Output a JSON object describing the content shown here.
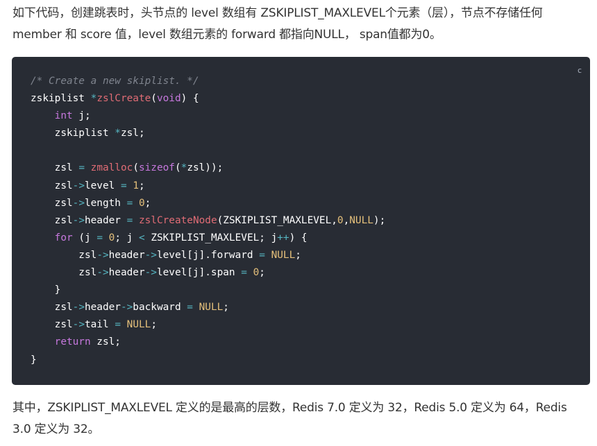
{
  "intro": {
    "text": "如下代码，创建跳表时，头节点的 level 数组有 ZSKIPLIST_MAXLEVEL个元素（层），节点不存储任何 member 和 score 值，level 数组元素的 forward 都指向NULL， span值都为0。"
  },
  "code_block": {
    "language_label": "c",
    "lines": [
      [
        [
          "com",
          "/* Create a new skiplist. */"
        ]
      ],
      [
        [
          "txt",
          "zskiplist "
        ],
        [
          "op",
          "*"
        ],
        [
          "fn",
          "zslCreate"
        ],
        [
          "txt",
          "("
        ],
        [
          "kw",
          "void"
        ],
        [
          "txt",
          ") {"
        ]
      ],
      [
        [
          "txt",
          "    "
        ],
        [
          "kw",
          "int"
        ],
        [
          "txt",
          " j;"
        ]
      ],
      [
        [
          "txt",
          "    zskiplist "
        ],
        [
          "op",
          "*"
        ],
        [
          "txt",
          "zsl;"
        ]
      ],
      [],
      [
        [
          "txt",
          "    zsl "
        ],
        [
          "op",
          "="
        ],
        [
          "txt",
          " "
        ],
        [
          "fn",
          "zmalloc"
        ],
        [
          "txt",
          "("
        ],
        [
          "kw",
          "sizeof"
        ],
        [
          "txt",
          "("
        ],
        [
          "op",
          "*"
        ],
        [
          "txt",
          "zsl));"
        ]
      ],
      [
        [
          "txt",
          "    zsl"
        ],
        [
          "op",
          "->"
        ],
        [
          "txt",
          "level "
        ],
        [
          "op",
          "="
        ],
        [
          "txt",
          " "
        ],
        [
          "num",
          "1"
        ],
        [
          "txt",
          ";"
        ]
      ],
      [
        [
          "txt",
          "    zsl"
        ],
        [
          "op",
          "->"
        ],
        [
          "txt",
          "length "
        ],
        [
          "op",
          "="
        ],
        [
          "txt",
          " "
        ],
        [
          "num",
          "0"
        ],
        [
          "txt",
          ";"
        ]
      ],
      [
        [
          "txt",
          "    zsl"
        ],
        [
          "op",
          "->"
        ],
        [
          "txt",
          "header "
        ],
        [
          "op",
          "="
        ],
        [
          "txt",
          " "
        ],
        [
          "fn",
          "zslCreateNode"
        ],
        [
          "txt",
          "(ZSKIPLIST_MAXLEVEL,"
        ],
        [
          "num",
          "0"
        ],
        [
          "txt",
          ","
        ],
        [
          "num",
          "NULL"
        ],
        [
          "txt",
          ");"
        ]
      ],
      [
        [
          "txt",
          "    "
        ],
        [
          "kw",
          "for"
        ],
        [
          "txt",
          " (j "
        ],
        [
          "op",
          "="
        ],
        [
          "txt",
          " "
        ],
        [
          "num",
          "0"
        ],
        [
          "txt",
          "; j "
        ],
        [
          "op",
          "<"
        ],
        [
          "txt",
          " ZSKIPLIST_MAXLEVEL; j"
        ],
        [
          "op",
          "++"
        ],
        [
          "txt",
          ") {"
        ]
      ],
      [
        [
          "txt",
          "        zsl"
        ],
        [
          "op",
          "->"
        ],
        [
          "txt",
          "header"
        ],
        [
          "op",
          "->"
        ],
        [
          "txt",
          "level[j].forward "
        ],
        [
          "op",
          "="
        ],
        [
          "txt",
          " "
        ],
        [
          "num",
          "NULL"
        ],
        [
          "txt",
          ";"
        ]
      ],
      [
        [
          "txt",
          "        zsl"
        ],
        [
          "op",
          "->"
        ],
        [
          "txt",
          "header"
        ],
        [
          "op",
          "->"
        ],
        [
          "txt",
          "level[j].span "
        ],
        [
          "op",
          "="
        ],
        [
          "txt",
          " "
        ],
        [
          "num",
          "0"
        ],
        [
          "txt",
          ";"
        ]
      ],
      [
        [
          "txt",
          "    }"
        ]
      ],
      [
        [
          "txt",
          "    zsl"
        ],
        [
          "op",
          "->"
        ],
        [
          "txt",
          "header"
        ],
        [
          "op",
          "->"
        ],
        [
          "txt",
          "backward "
        ],
        [
          "op",
          "="
        ],
        [
          "txt",
          " "
        ],
        [
          "num",
          "NULL"
        ],
        [
          "txt",
          ";"
        ]
      ],
      [
        [
          "txt",
          "    zsl"
        ],
        [
          "op",
          "->"
        ],
        [
          "txt",
          "tail "
        ],
        [
          "op",
          "="
        ],
        [
          "txt",
          " "
        ],
        [
          "num",
          "NULL"
        ],
        [
          "txt",
          ";"
        ]
      ],
      [
        [
          "txt",
          "    "
        ],
        [
          "kw",
          "return"
        ],
        [
          "txt",
          " zsl;"
        ]
      ],
      [
        [
          "txt",
          "}"
        ]
      ]
    ]
  },
  "outro": {
    "text": "其中，ZSKIPLIST_MAXLEVEL 定义的是最高的层数，Redis 7.0 定义为 32，Redis 5.0 定义为 64，Redis 3.0 定义为 32。"
  },
  "colors": {
    "code_background": "#282c34",
    "comment": "#7f848e",
    "function": "#e06c75",
    "keyword": "#c678dd",
    "number": "#e5c07b",
    "operator": "#56b6c2"
  }
}
